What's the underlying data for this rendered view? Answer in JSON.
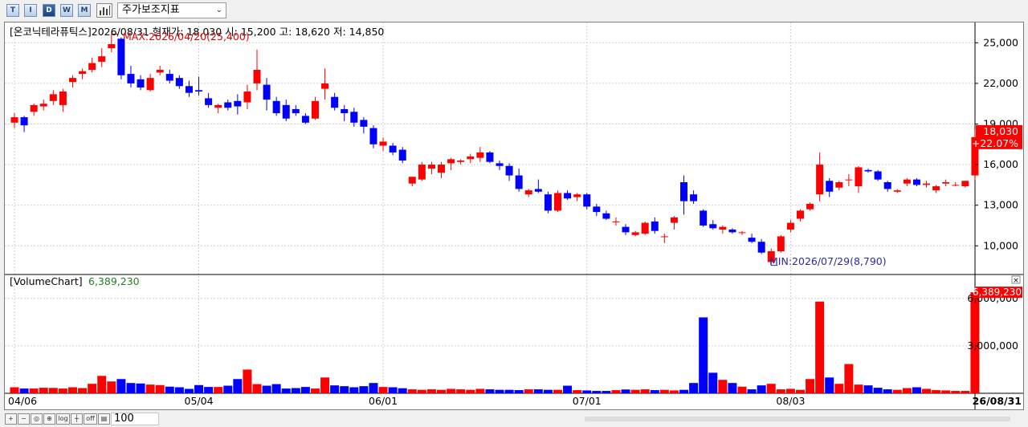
{
  "toolbar": {
    "buttons": [
      {
        "label": "T",
        "active": false
      },
      {
        "label": "I",
        "active": false
      },
      {
        "label": "D",
        "active": true
      },
      {
        "label": "W",
        "active": false
      },
      {
        "label": "M",
        "active": false
      }
    ],
    "indicator_combo": "주가보조지표"
  },
  "price_panel": {
    "info": "[온코닉테라퓨틱스]2026/08/31 현재가: 18,030 시: 15,200 고: 18,620 저: 14,850",
    "max_label": "MAX:2026/04/20(25,400)",
    "min_label": "MIN:2026/07/29(8,790)",
    "last_price": "18,030",
    "last_change": "+22.07%",
    "y_labels": [
      "25,000",
      "22,000",
      "19,000",
      "16,000",
      "13,000",
      "10,000"
    ]
  },
  "volume_panel": {
    "title": "[VolumeChart]",
    "value": "6,389,230",
    "last_label": "6,389,230",
    "y_labels": [
      "6,000,000",
      "3,000,000"
    ]
  },
  "x_labels": [
    "04/06",
    "05/04",
    "06/01",
    "07/01",
    "08/03",
    "26/08/31"
  ],
  "bottombar": {
    "log_label": "log",
    "off_label": "off",
    "zoom": "100"
  },
  "colors": {
    "up": "#ff0000",
    "down": "#0000ff",
    "grid": "#d0d0d0"
  },
  "chart_data": {
    "type": "candlestick",
    "unit": "KRW",
    "ohlc": [
      {
        "o": 19100,
        "h": 19800,
        "l": 18700,
        "c": 19500
      },
      {
        "o": 19500,
        "h": 19600,
        "l": 18400,
        "c": 18900
      },
      {
        "o": 19900,
        "h": 20500,
        "l": 19600,
        "c": 20400
      },
      {
        "o": 20300,
        "h": 20800,
        "l": 20000,
        "c": 20500
      },
      {
        "o": 20700,
        "h": 21500,
        "l": 20400,
        "c": 21200
      },
      {
        "o": 20400,
        "h": 21600,
        "l": 19900,
        "c": 21400
      },
      {
        "o": 22100,
        "h": 22600,
        "l": 21700,
        "c": 22400
      },
      {
        "o": 22700,
        "h": 23100,
        "l": 22300,
        "c": 22900
      },
      {
        "o": 23000,
        "h": 23900,
        "l": 22800,
        "c": 23500
      },
      {
        "o": 23600,
        "h": 24600,
        "l": 23200,
        "c": 24000
      },
      {
        "o": 24600,
        "h": 25400,
        "l": 24300,
        "c": 24900
      },
      {
        "o": 25300,
        "h": 25400,
        "l": 22300,
        "c": 22600
      },
      {
        "o": 22700,
        "h": 23300,
        "l": 21700,
        "c": 22000
      },
      {
        "o": 22300,
        "h": 22600,
        "l": 21500,
        "c": 21700
      },
      {
        "o": 21500,
        "h": 22700,
        "l": 21400,
        "c": 22400
      },
      {
        "o": 22800,
        "h": 23300,
        "l": 22600,
        "c": 23000
      },
      {
        "o": 22700,
        "h": 23000,
        "l": 22000,
        "c": 22200
      },
      {
        "o": 22400,
        "h": 22600,
        "l": 21600,
        "c": 21800
      },
      {
        "o": 21800,
        "h": 22200,
        "l": 21000,
        "c": 21300
      },
      {
        "o": 21500,
        "h": 22500,
        "l": 21100,
        "c": 21400
      },
      {
        "o": 20900,
        "h": 21300,
        "l": 20200,
        "c": 20400
      },
      {
        "o": 20200,
        "h": 20500,
        "l": 19800,
        "c": 20400
      },
      {
        "o": 20600,
        "h": 20800,
        "l": 20000,
        "c": 20200
      },
      {
        "o": 20700,
        "h": 21200,
        "l": 19700,
        "c": 20300
      },
      {
        "o": 20600,
        "h": 21900,
        "l": 20100,
        "c": 21400
      },
      {
        "o": 22000,
        "h": 24500,
        "l": 21500,
        "c": 23000
      },
      {
        "o": 21900,
        "h": 22400,
        "l": 20000,
        "c": 20800
      },
      {
        "o": 20700,
        "h": 21000,
        "l": 19600,
        "c": 19800
      },
      {
        "o": 20400,
        "h": 20800,
        "l": 19200,
        "c": 19400
      },
      {
        "o": 20100,
        "h": 20400,
        "l": 19600,
        "c": 19800
      },
      {
        "o": 19600,
        "h": 19800,
        "l": 19000,
        "c": 19100
      },
      {
        "o": 19400,
        "h": 21000,
        "l": 19300,
        "c": 20700
      },
      {
        "o": 21600,
        "h": 23100,
        "l": 20800,
        "c": 22000
      },
      {
        "o": 21000,
        "h": 21300,
        "l": 20000,
        "c": 20200
      },
      {
        "o": 20100,
        "h": 20400,
        "l": 19200,
        "c": 19800
      },
      {
        "o": 19900,
        "h": 20200,
        "l": 18800,
        "c": 19100
      },
      {
        "o": 19300,
        "h": 19500,
        "l": 18300,
        "c": 18800
      },
      {
        "o": 18700,
        "h": 18900,
        "l": 17200,
        "c": 17500
      },
      {
        "o": 17400,
        "h": 18000,
        "l": 17000,
        "c": 17700
      },
      {
        "o": 17400,
        "h": 17600,
        "l": 16700,
        "c": 16900
      },
      {
        "o": 17100,
        "h": 17300,
        "l": 16100,
        "c": 16300
      },
      {
        "o": 14600,
        "h": 15100,
        "l": 14400,
        "c": 15100
      },
      {
        "o": 14900,
        "h": 16200,
        "l": 14800,
        "c": 16000
      },
      {
        "o": 15700,
        "h": 16200,
        "l": 15300,
        "c": 16000
      },
      {
        "o": 15400,
        "h": 16200,
        "l": 15000,
        "c": 16000
      },
      {
        "o": 16100,
        "h": 16500,
        "l": 15600,
        "c": 16400
      },
      {
        "o": 16200,
        "h": 16400,
        "l": 16000,
        "c": 16300
      },
      {
        "o": 16400,
        "h": 16800,
        "l": 16100,
        "c": 16600
      },
      {
        "o": 16500,
        "h": 17300,
        "l": 16200,
        "c": 16900
      },
      {
        "o": 16900,
        "h": 17000,
        "l": 16100,
        "c": 16200
      },
      {
        "o": 16100,
        "h": 16300,
        "l": 15600,
        "c": 15900
      },
      {
        "o": 15900,
        "h": 16100,
        "l": 14800,
        "c": 15200
      },
      {
        "o": 15200,
        "h": 15700,
        "l": 14000,
        "c": 14200
      },
      {
        "o": 13800,
        "h": 14200,
        "l": 13600,
        "c": 14100
      },
      {
        "o": 14200,
        "h": 14900,
        "l": 13900,
        "c": 14000
      },
      {
        "o": 13800,
        "h": 14000,
        "l": 12400,
        "c": 12600
      },
      {
        "o": 12600,
        "h": 14100,
        "l": 12500,
        "c": 13900
      },
      {
        "o": 13900,
        "h": 14100,
        "l": 13400,
        "c": 13500
      },
      {
        "o": 13600,
        "h": 13900,
        "l": 13300,
        "c": 13800
      },
      {
        "o": 13800,
        "h": 13900,
        "l": 12700,
        "c": 12900
      },
      {
        "o": 12900,
        "h": 13100,
        "l": 12200,
        "c": 12500
      },
      {
        "o": 12400,
        "h": 12600,
        "l": 11900,
        "c": 12000
      },
      {
        "o": 11800,
        "h": 12100,
        "l": 11500,
        "c": 11800
      },
      {
        "o": 11400,
        "h": 11600,
        "l": 10800,
        "c": 11000
      },
      {
        "o": 10800,
        "h": 11100,
        "l": 10700,
        "c": 11000
      },
      {
        "o": 10900,
        "h": 11800,
        "l": 10800,
        "c": 11700
      },
      {
        "o": 11800,
        "h": 12100,
        "l": 10900,
        "c": 11100
      },
      {
        "o": 10700,
        "h": 10900,
        "l": 10200,
        "c": 10700
      },
      {
        "o": 11700,
        "h": 12200,
        "l": 11200,
        "c": 12100
      },
      {
        "o": 14700,
        "h": 15200,
        "l": 12300,
        "c": 13300
      },
      {
        "o": 13800,
        "h": 14100,
        "l": 13100,
        "c": 13300
      },
      {
        "o": 12600,
        "h": 12700,
        "l": 11400,
        "c": 11500
      },
      {
        "o": 11600,
        "h": 11900,
        "l": 11200,
        "c": 11300
      },
      {
        "o": 11200,
        "h": 11500,
        "l": 10900,
        "c": 11400
      },
      {
        "o": 11200,
        "h": 11300,
        "l": 10900,
        "c": 11000
      },
      {
        "o": 11000,
        "h": 11100,
        "l": 10800,
        "c": 11000
      },
      {
        "o": 10600,
        "h": 10900,
        "l": 10200,
        "c": 10300
      },
      {
        "o": 10300,
        "h": 10500,
        "l": 9400,
        "c": 9500
      },
      {
        "o": 8800,
        "h": 9800,
        "l": 8790,
        "c": 9600
      },
      {
        "o": 9600,
        "h": 10800,
        "l": 9500,
        "c": 10700
      },
      {
        "o": 11200,
        "h": 11900,
        "l": 11000,
        "c": 11700
      },
      {
        "o": 12000,
        "h": 12700,
        "l": 11800,
        "c": 12600
      },
      {
        "o": 12700,
        "h": 13200,
        "l": 12600,
        "c": 13100
      },
      {
        "o": 13800,
        "h": 16900,
        "l": 13300,
        "c": 16000
      },
      {
        "o": 14800,
        "h": 15000,
        "l": 13600,
        "c": 14000
      },
      {
        "o": 14300,
        "h": 14800,
        "l": 14100,
        "c": 14700
      },
      {
        "o": 14900,
        "h": 15300,
        "l": 14400,
        "c": 14900
      },
      {
        "o": 14400,
        "h": 15900,
        "l": 13900,
        "c": 15800
      },
      {
        "o": 15600,
        "h": 15700,
        "l": 15400,
        "c": 15500
      },
      {
        "o": 15500,
        "h": 15600,
        "l": 14800,
        "c": 14900
      },
      {
        "o": 14700,
        "h": 14800,
        "l": 14000,
        "c": 14200
      },
      {
        "o": 14000,
        "h": 14200,
        "l": 13900,
        "c": 14100
      },
      {
        "o": 14600,
        "h": 15000,
        "l": 14400,
        "c": 14900
      },
      {
        "o": 14900,
        "h": 15000,
        "l": 14400,
        "c": 14500
      },
      {
        "o": 14500,
        "h": 14800,
        "l": 14300,
        "c": 14600
      },
      {
        "o": 14100,
        "h": 14500,
        "l": 13900,
        "c": 14400
      },
      {
        "o": 14600,
        "h": 14900,
        "l": 14400,
        "c": 14700
      },
      {
        "o": 14500,
        "h": 14700,
        "l": 14400,
        "c": 14500
      },
      {
        "o": 14400,
        "h": 14800,
        "l": 14300,
        "c": 14800
      },
      {
        "o": 15200,
        "h": 18620,
        "l": 14850,
        "c": 18030
      }
    ],
    "volume": [
      380000,
      300000,
      300000,
      350000,
      340000,
      300000,
      380000,
      330000,
      600000,
      1100000,
      750000,
      900000,
      650000,
      620000,
      550000,
      520000,
      420000,
      380000,
      280000,
      520000,
      400000,
      400000,
      480000,
      900000,
      1500000,
      580000,
      480000,
      580000,
      300000,
      330000,
      400000,
      300000,
      1000000,
      500000,
      450000,
      380000,
      450000,
      650000,
      400000,
      380000,
      320000,
      250000,
      220000,
      250000,
      220000,
      280000,
      250000,
      220000,
      280000,
      250000,
      220000,
      220000,
      200000,
      250000,
      250000,
      220000,
      220000,
      480000,
      200000,
      180000,
      150000,
      150000,
      200000,
      240000,
      220000,
      250000,
      200000,
      220000,
      180000,
      220000,
      650000,
      4800000,
      1300000,
      850000,
      650000,
      420000,
      250000,
      500000,
      600000,
      250000,
      280000,
      220000,
      900000,
      5800000,
      1000000,
      600000,
      1850000,
      550000,
      500000,
      350000,
      250000,
      220000,
      330000,
      380000,
      280000,
      200000,
      180000,
      150000,
      150000,
      6389230
    ],
    "x_tick_labels": [
      "04/06",
      "05/04",
      "06/01",
      "07/01",
      "08/03",
      "26/08/31"
    ],
    "price_ylim": [
      8000,
      26500
    ],
    "volume_ylim": [
      0,
      6800000
    ]
  }
}
